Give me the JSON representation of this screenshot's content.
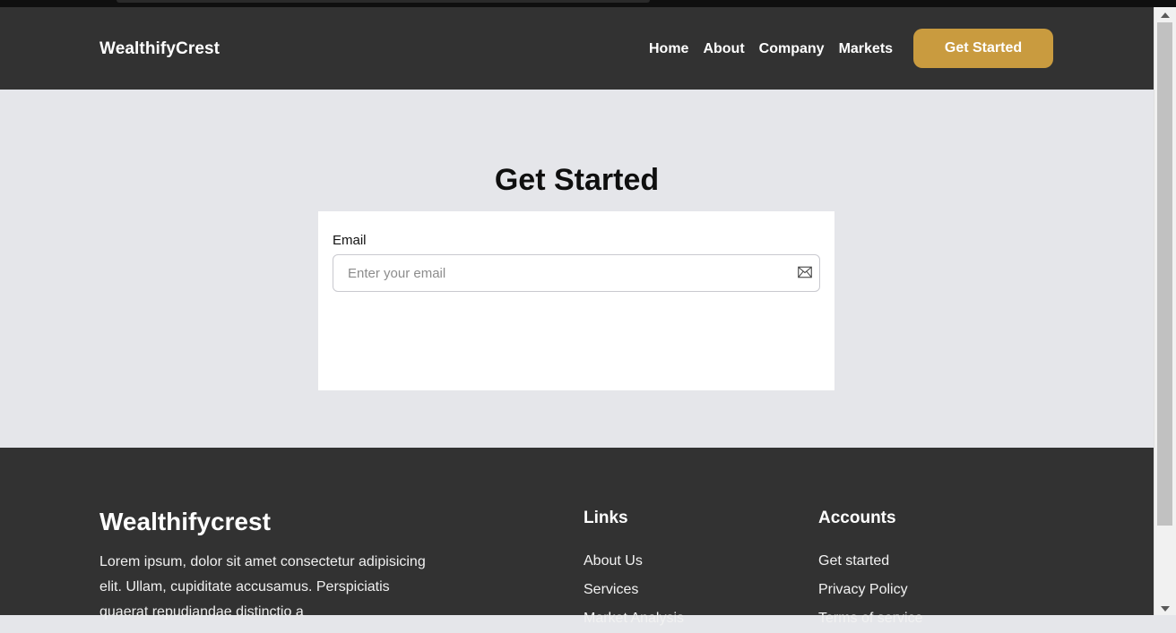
{
  "header": {
    "brand": "WealthifyCrest",
    "nav": [
      "Home",
      "About",
      "Company",
      "Markets"
    ],
    "cta_label": "Get Started"
  },
  "main": {
    "title": "Get Started",
    "form": {
      "email_label": "Email",
      "email_placeholder": "Enter your email",
      "email_value": ""
    }
  },
  "footer": {
    "brand": "Wealthifycrest",
    "description": "Lorem ipsum, dolor sit amet consectetur adipisicing elit. Ullam, cupiditate accusamus. Perspiciatis quaerat repudiandae distinctio a",
    "links_title": "Links",
    "links": [
      "About Us",
      "Services",
      "Market Analysis"
    ],
    "accounts_title": "Accounts",
    "accounts": [
      "Get started",
      "Privacy Policy",
      "Terms of service"
    ]
  },
  "colors": {
    "header_bg": "#323232",
    "accent": "#c99b3f",
    "page_bg": "#e5e6ea",
    "card_bg": "#ffffff"
  },
  "icons": {
    "email_field": "mail-icon"
  }
}
